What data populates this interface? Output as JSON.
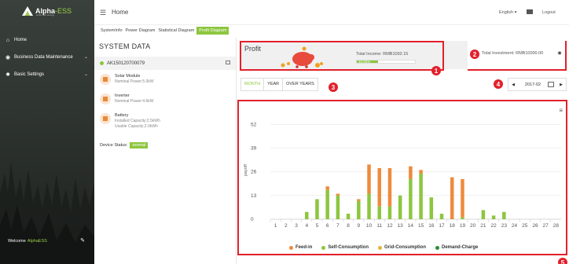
{
  "brand": {
    "name": "Alpha",
    "suffix": "-ESS",
    "tagline": "smile with energy"
  },
  "header": {
    "title": "Home",
    "language": "English",
    "logout": "Logout"
  },
  "sidebar": {
    "items": [
      {
        "label": "Home",
        "icon": "home-icon"
      },
      {
        "label": "Business Data Maintenance",
        "icon": "eye-icon"
      },
      {
        "label": "Basic Settings",
        "icon": "gear-icon"
      }
    ],
    "welcome": "Welcome",
    "user": "AlphaESS"
  },
  "subtabs": [
    "SystemInfo",
    "Power Diagram",
    "Statistical Diagram",
    "Profit Diagram"
  ],
  "active_subtab": "Profit Diagram",
  "system": {
    "title": "SYSTEM DATA",
    "serial": "AK150120700079",
    "components": [
      {
        "name": "Solar Module",
        "value": "Nominal Power:5.0kW"
      },
      {
        "name": "Inverter",
        "value": "Nominal Power:4.6kW"
      },
      {
        "name": "Battery",
        "value": "Installed Capacity:2.5kWh",
        "value2": "Usable Capacity:2.0kWh"
      }
    ],
    "status_label": "Device Status:",
    "status_value": "normal"
  },
  "profit": {
    "title": "Profit",
    "total_income": "Total Income: RMB1092.15",
    "percent": "10.92%",
    "percent_fraction": 0.1092,
    "total_investment": "Total Investment: RMB10000.00"
  },
  "periods": [
    "MONTH",
    "YEAR",
    "OVER YEARS"
  ],
  "active_period": "MONTH",
  "date": "2017-02",
  "markers": [
    "1",
    "2",
    "3",
    "4",
    "5"
  ],
  "colors": {
    "feed_in": "#ee8a3c",
    "self_consumption": "#8cc63f",
    "grid_consumption": "#e8b23c",
    "demand_charge": "#2e8b3e",
    "accent": "#8cc63f",
    "highlight": "#e2202b"
  },
  "chart_data": {
    "type": "bar",
    "ylabel": "payoff",
    "yticks": [
      0,
      13,
      26,
      39,
      52
    ],
    "ylim": [
      0,
      56
    ],
    "categories": [
      "1",
      "2",
      "3",
      "4",
      "5",
      "6",
      "7",
      "8",
      "9",
      "10",
      "11",
      "12",
      "13",
      "14",
      "15",
      "16",
      "17",
      "18",
      "19",
      "20",
      "21",
      "22",
      "23",
      "24",
      "25",
      "26",
      "27",
      "28"
    ],
    "series": [
      {
        "name": "Self-Consumption",
        "values": [
          0,
          0,
          0,
          4,
          11,
          16,
          13,
          3,
          10,
          14,
          7,
          7,
          13,
          22,
          25,
          12,
          3,
          0,
          1,
          0,
          5,
          2,
          4,
          0,
          0,
          0,
          0,
          0
        ]
      },
      {
        "name": "Feed-in",
        "values": [
          0,
          0,
          0,
          0,
          0,
          2,
          1,
          0,
          1,
          16,
          21,
          21,
          0,
          7,
          2,
          0,
          0,
          23,
          21,
          0,
          0,
          0,
          0,
          0,
          0,
          0,
          0,
          0
        ]
      },
      {
        "name": "Grid-Consumption",
        "values": [
          0,
          0,
          0,
          0,
          0,
          0,
          0,
          0,
          0,
          0,
          0,
          0,
          0,
          0,
          0,
          0,
          0,
          0,
          0,
          0,
          0,
          0,
          0,
          0,
          0,
          0,
          0,
          0
        ]
      },
      {
        "name": "Demand-Charge",
        "values": [
          0,
          0,
          0,
          0,
          0,
          0,
          0,
          0,
          0,
          0,
          0,
          0,
          0,
          0,
          0,
          0,
          0,
          0,
          0,
          0,
          0,
          0,
          0,
          0,
          0,
          0,
          0,
          0
        ]
      }
    ]
  }
}
